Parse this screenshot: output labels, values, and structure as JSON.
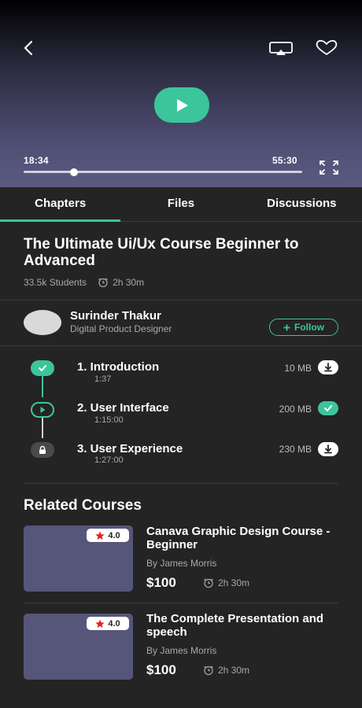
{
  "player": {
    "current_time": "18:34",
    "total_time": "55:30",
    "progress": 0.18
  },
  "tabs": [
    {
      "label": "Chapters",
      "active": true
    },
    {
      "label": "Files",
      "active": false
    },
    {
      "label": "Discussions",
      "active": false
    }
  ],
  "course": {
    "title": "The Ultimate Ui/Ux Course Beginner to Advanced",
    "students": "33.5k Students",
    "duration": "2h 30m"
  },
  "instructor": {
    "name": "Surinder Thakur",
    "role": "Digital Product Designer",
    "follow_label": "Follow"
  },
  "chapters": [
    {
      "title": "1. Introduction",
      "length": "1:37",
      "size": "10 MB",
      "status": "completed",
      "action": "download"
    },
    {
      "title": "2. User Interface",
      "length": "1:15:00",
      "size": "200 MB",
      "status": "playing",
      "action": "downloaded"
    },
    {
      "title": "3. User Experience",
      "length": "1:27:00",
      "size": "230 MB",
      "status": "locked",
      "action": "download"
    }
  ],
  "related": {
    "heading": "Related Courses",
    "items": [
      {
        "title": "Canava Graphic Design Course - Beginner",
        "author": "By James Morris",
        "price": "$100",
        "duration": "2h 30m",
        "rating": "4.0"
      },
      {
        "title": "The Complete Presentation and speech",
        "author": "By James Morris",
        "price": "$100",
        "duration": "2h 30m",
        "rating": "4.0"
      }
    ]
  },
  "colors": {
    "accent": "#3cc59a",
    "background": "#242424",
    "thumbnail": "#56557a",
    "star": "#e52222"
  }
}
